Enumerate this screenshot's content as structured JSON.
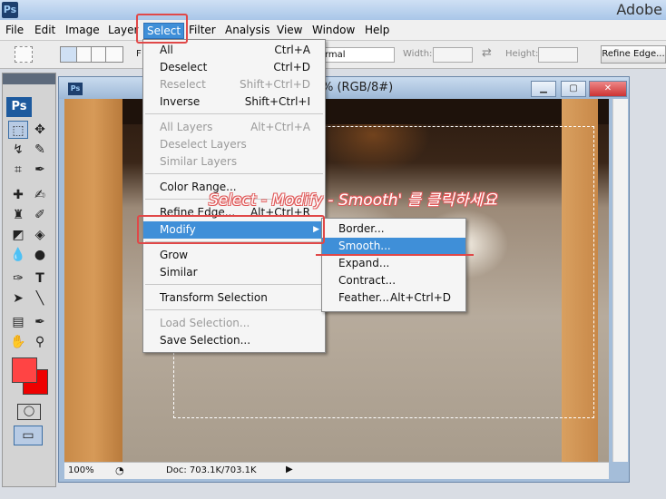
{
  "app": {
    "title": "Adobe",
    "logo": "Ps"
  },
  "menubar": {
    "items": [
      "File",
      "Edit",
      "Image",
      "Layer",
      "Select",
      "Filter",
      "Analysis",
      "View",
      "Window",
      "Help"
    ],
    "active": "Select"
  },
  "options": {
    "feather_label": "F",
    "style_value": "rmal",
    "width_label": "Width:",
    "height_label": "Height:",
    "refine_edge_button": "Refine Edge..."
  },
  "toolbox": {
    "logo": "Ps",
    "foreground_color": "#ff4444",
    "background_color": "#ee0000"
  },
  "document": {
    "title_suffix": "% (RGB/8#)",
    "icon": "Ps",
    "zoom": "100%",
    "doc_info": "Doc: 703.1K/703.1K"
  },
  "select_menu": {
    "items": [
      {
        "label": "All",
        "shortcut": "Ctrl+A",
        "enabled": true
      },
      {
        "label": "Deselect",
        "shortcut": "Ctrl+D",
        "enabled": true
      },
      {
        "label": "Reselect",
        "shortcut": "Shift+Ctrl+D",
        "enabled": false
      },
      {
        "label": "Inverse",
        "shortcut": "Shift+Ctrl+I",
        "enabled": true
      },
      {
        "label": "All Layers",
        "shortcut": "Alt+Ctrl+A",
        "enabled": false
      },
      {
        "label": "Deselect Layers",
        "shortcut": "",
        "enabled": false
      },
      {
        "label": "Similar Layers",
        "shortcut": "",
        "enabled": false
      },
      {
        "label": "Color Range...",
        "shortcut": "",
        "enabled": true
      },
      {
        "label": "Refine Edge...",
        "shortcut": "Alt+Ctrl+R",
        "enabled": true
      },
      {
        "label": "Modify",
        "shortcut": "",
        "enabled": true,
        "submenu": true
      },
      {
        "label": "Grow",
        "shortcut": "",
        "enabled": true
      },
      {
        "label": "Similar",
        "shortcut": "",
        "enabled": true
      },
      {
        "label": "Transform Selection",
        "shortcut": "",
        "enabled": true
      },
      {
        "label": "Load Selection...",
        "shortcut": "",
        "enabled": false
      },
      {
        "label": "Save Selection...",
        "shortcut": "",
        "enabled": true
      }
    ]
  },
  "modify_submenu": {
    "items": [
      {
        "label": "Border...",
        "shortcut": ""
      },
      {
        "label": "Smooth...",
        "shortcut": ""
      },
      {
        "label": "Expand...",
        "shortcut": ""
      },
      {
        "label": "Contract...",
        "shortcut": ""
      },
      {
        "label": "Feather...",
        "shortcut": "Alt+Ctrl+D"
      }
    ],
    "highlighted": "Smooth..."
  },
  "annotation": {
    "instruction": "Select - Modify - Smooth' 를 클릭하세요",
    "color": "#e04848"
  }
}
